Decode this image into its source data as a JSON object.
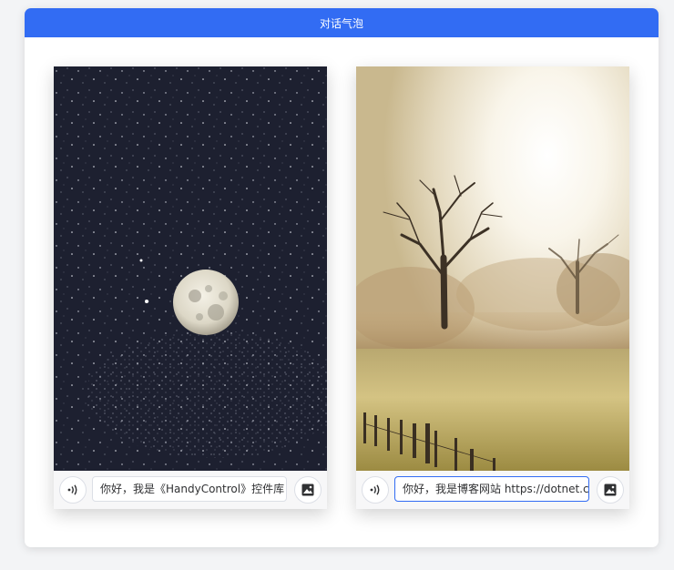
{
  "window": {
    "title": "对话气泡"
  },
  "bubbles": [
    {
      "text": "你好，我是《HandyControl》控件库"
    },
    {
      "text": "你好，我是博客网站 https://dotnet.cnblogs.com"
    }
  ],
  "icons": {
    "voice": "voice-wave-icon",
    "image": "image-icon"
  },
  "colors": {
    "accent": "#326cf3"
  }
}
